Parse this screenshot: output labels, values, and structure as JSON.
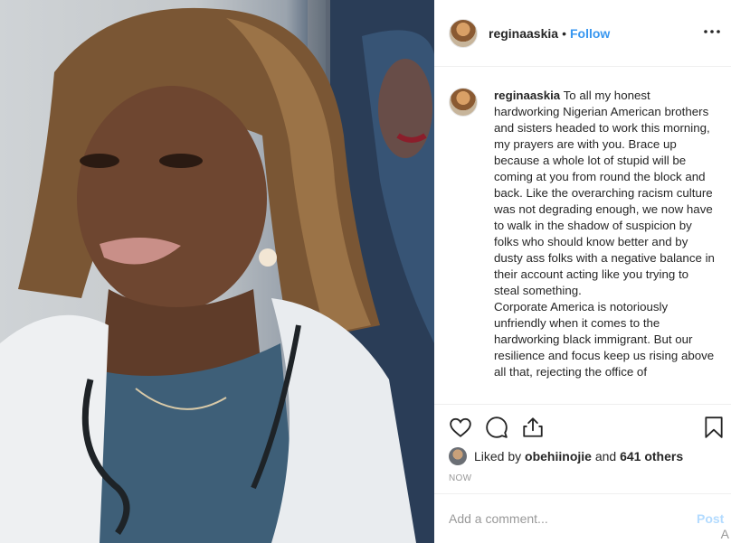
{
  "post": {
    "username": "reginaaskia",
    "follow_label": "Follow",
    "header_separator": "•",
    "caption": "To all my honest hardworking Nigerian American brothers and sisters headed to work this morning, my prayers are with you. Brace up because a whole lot of stupid will be coming at you from round the block and back. Like the overarching racism culture was not degrading enough, we now have to walk in the shadow of suspicion by folks who should know better and by dusty ass folks with a negative balance in their account acting like you trying to steal something.\nCorporate America is notoriously unfriendly when it comes to the hardworking black immigrant. But our resilience and focus keep us rising above all that, rejecting the office of",
    "likes": {
      "prefix": "Liked by",
      "user": "obehiinojie",
      "and": "and",
      "count": "641 others"
    },
    "timestamp": "NOW"
  },
  "comment": {
    "placeholder": "Add a comment...",
    "post_label": "Post"
  },
  "icons": {
    "more": "more-options-icon",
    "like": "heart-icon",
    "comment": "comment-icon",
    "share": "share-icon",
    "save": "bookmark-icon"
  },
  "colors": {
    "accent": "#3897f0",
    "post_disabled": "#b3dbff",
    "muted": "#999999"
  },
  "corner_glyph": "A"
}
